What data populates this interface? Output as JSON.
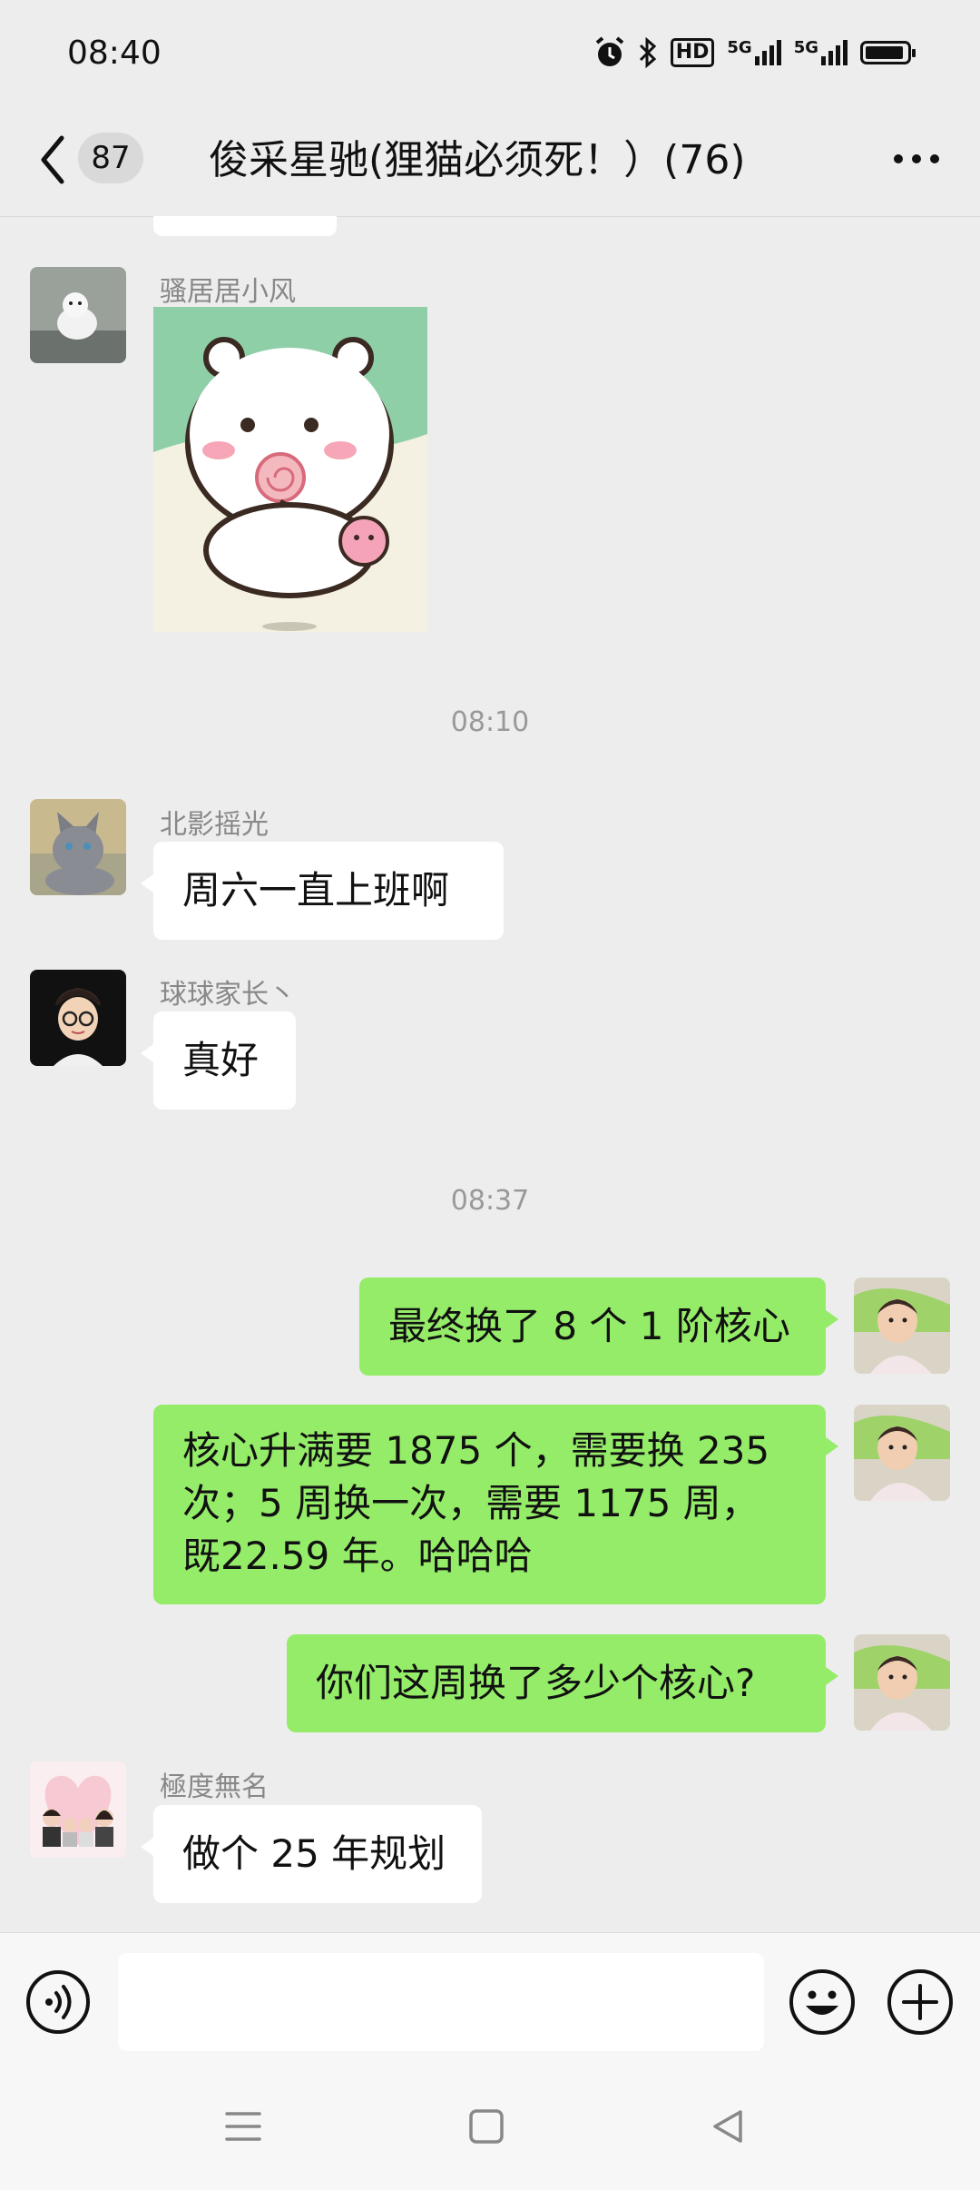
{
  "status_bar": {
    "time": "08:40",
    "icons": [
      "alarm-icon",
      "bluetooth-icon",
      "hd-icon",
      "signal-5g-icon",
      "signal-5g-icon",
      "battery-icon"
    ],
    "hd_label": "HD",
    "net1": "5G",
    "net2": "5G"
  },
  "header": {
    "back_badge": "87",
    "title": "俊采星驰(狸猫必须死！）(76)"
  },
  "messages": [
    {
      "type": "sticker",
      "sender": "骚居居小风",
      "side": "in",
      "avatar": "white-dog"
    },
    {
      "type": "time",
      "text": "08:10"
    },
    {
      "type": "text",
      "sender": "北影摇光",
      "side": "in",
      "text": "周六一直上班啊",
      "avatar": "grey-cat"
    },
    {
      "type": "text",
      "sender": "球球家长丶",
      "side": "in",
      "text": "真好",
      "avatar": "cartoon-boy"
    },
    {
      "type": "time",
      "text": "08:37"
    },
    {
      "type": "text",
      "side": "out",
      "text": "最终换了 8 个 1 阶核心",
      "avatar": "baby-photo"
    },
    {
      "type": "text",
      "side": "out",
      "lines": [
        "核心升满要 1875 个，需要换 235",
        "次；5 周换一次，需要 1175 周，",
        "既22.59 年。哈哈哈"
      ],
      "avatar": "baby-photo"
    },
    {
      "type": "text",
      "side": "out",
      "text": "你们这周换了多少个核心?",
      "avatar": "baby-photo"
    },
    {
      "type": "text",
      "sender": "極度無名",
      "side": "in",
      "text": "做个 25 年规划",
      "avatar": "family-cartoon"
    }
  ],
  "input": {
    "placeholder": ""
  },
  "colors": {
    "background": "#ededed",
    "outgoing_bubble": "#95ec69",
    "incoming_bubble": "#ffffff",
    "meta_text": "#999999"
  }
}
